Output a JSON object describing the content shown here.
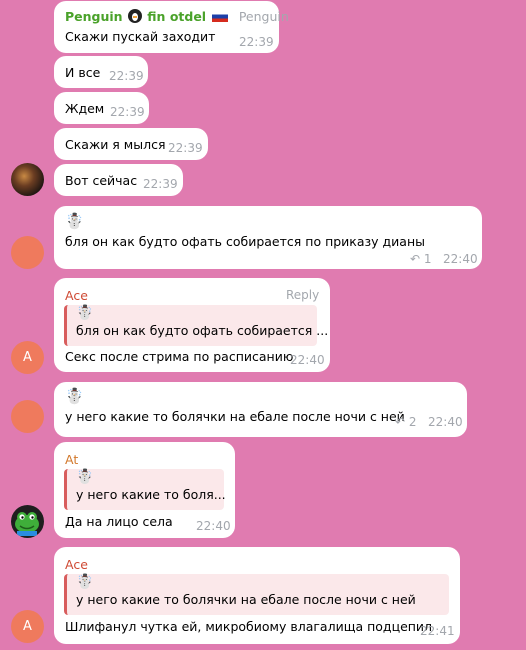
{
  "messages": [
    {
      "sender": "Penguin",
      "sender_suffix": "fin otdel",
      "role": "Penguin",
      "text": "Скажи пускай заходит",
      "time": "22:39"
    },
    {
      "text": "И все",
      "time": "22:39"
    },
    {
      "text": "Ждем",
      "time": "22:39"
    },
    {
      "text": "Скажи я мылся",
      "time": "22:39"
    },
    {
      "text": "Вот сейчас",
      "time": "22:39"
    },
    {
      "emoji": "☃️",
      "text": "бля он как будто офать собирается по приказу дианы",
      "replies": "1",
      "time": "22:40"
    },
    {
      "sender": "Ace",
      "action": "Reply",
      "quote_emoji": "☃️",
      "quote": "бля он как будто офать собирается ...",
      "text": "Секс после стрима по расписанию",
      "time": "22:40"
    },
    {
      "emoji": "☃️",
      "text": "у него какие то болячки на ебале после ночи с ней",
      "replies": "2",
      "time": "22:40"
    },
    {
      "sender": "At",
      "quote_emoji": "☃️",
      "quote": "у него какие то боля...",
      "text": "Да на лицо села",
      "time": "22:40"
    },
    {
      "sender": "Ace",
      "quote_emoji": "☃️",
      "quote": "у него какие то болячки на ебале после ночи с ней",
      "text": "Шлифанул чутка ей, микробиому влагалища подцепил",
      "time": "22:41"
    }
  ],
  "avatars": {
    "ace_letter": "A",
    "reply_icon": "reply-arrow-icon"
  },
  "colors": {
    "background": "#e07bb0",
    "bubble": "#ffffff",
    "quote_bar": "#d85d5d"
  }
}
